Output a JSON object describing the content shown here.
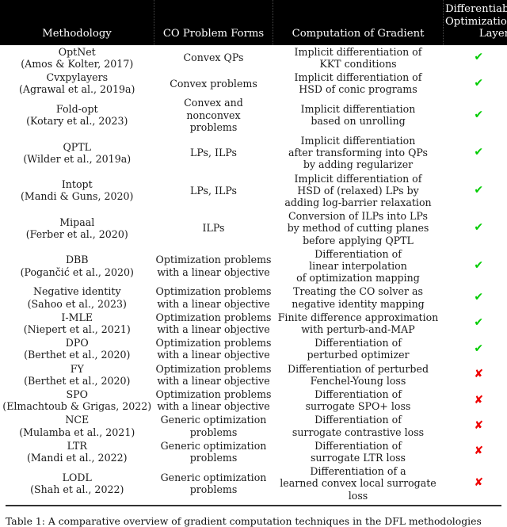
{
  "table": {
    "columns": [
      {
        "label": "Methodology"
      },
      {
        "label": "CO Problem Forms"
      },
      {
        "label": "Computation of Gradient"
      },
      {
        "label": "Differentiable\nOptimization\nLayer"
      }
    ],
    "marks": {
      "yes": "✔",
      "no": "✘"
    },
    "colors": {
      "yes": "#00cc00",
      "no": "#ee0000",
      "header_bg": "#000000",
      "header_fg": "#ffffff"
    },
    "rows": [
      {
        "methodology": "OptNet\n(Amos & Kolter, 2017)",
        "problem_forms": "Convex QPs",
        "gradient": "Implicit differentiation of\nKKT conditions",
        "layer": "yes"
      },
      {
        "methodology": "Cvxpylayers\n(Agrawal et al., 2019a)",
        "problem_forms": "Convex problems",
        "gradient": "Implicit differentiation of\nHSD of conic programs",
        "layer": "yes"
      },
      {
        "methodology": "Fold-opt\n(Kotary et al., 2023)",
        "problem_forms": "Convex and nonconvex\nproblems",
        "gradient": "Implicit differentiation\nbased on unrolling",
        "layer": "yes"
      },
      {
        "methodology": "QPTL\n(Wilder et al., 2019a)",
        "problem_forms": "LPs, ILPs",
        "gradient": "Implicit differentiation\nafter transforming into QPs\nby adding regularizer",
        "layer": "yes"
      },
      {
        "methodology": "Intopt\n(Mandi & Guns, 2020)",
        "problem_forms": "LPs, ILPs",
        "gradient": "Implicit differentiation of\nHSD of (relaxed) LPs by\nadding log-barrier relaxation",
        "layer": "yes"
      },
      {
        "methodology": "Mipaal\n(Ferber et al., 2020)",
        "problem_forms": "ILPs",
        "gradient": "Conversion of ILPs into LPs\nby method of cutting planes\nbefore applying QPTL",
        "layer": "yes"
      },
      {
        "methodology": "DBB\n(Pogančić et al., 2020)",
        "problem_forms": "Optimization problems\nwith a linear objective",
        "gradient": "Differentiation of\nlinear interpolation\nof optimization mapping",
        "layer": "yes"
      },
      {
        "methodology": "Negative identity\n(Sahoo et al., 2023)",
        "problem_forms": "Optimization problems\nwith a linear objective",
        "gradient": "Treating the CO solver as\nnegative identity mapping",
        "layer": "yes"
      },
      {
        "methodology": "I-MLE\n(Niepert et al., 2021)",
        "problem_forms": "Optimization problems\nwith a linear objective",
        "gradient": "Finite difference approximation\nwith perturb-and-MAP",
        "layer": "yes"
      },
      {
        "methodology": "DPO\n(Berthet et al., 2020)",
        "problem_forms": "Optimization problems\nwith a linear objective",
        "gradient": "Differentiation of\nperturbed optimizer",
        "layer": "yes"
      },
      {
        "methodology": "FY\n(Berthet et al., 2020)",
        "problem_forms": "Optimization problems\nwith a linear objective",
        "gradient": "Differentiation of perturbed\nFenchel-Young loss",
        "layer": "no"
      },
      {
        "methodology": "SPO\n(Elmachtoub & Grigas, 2022)",
        "problem_forms": "Optimization problems\nwith a linear objective",
        "gradient": "Differentiation of\nsurrogate SPO+ loss",
        "layer": "no"
      },
      {
        "methodology": "NCE\n(Mulamba et al., 2021)",
        "problem_forms": "Generic optimization\nproblems",
        "gradient": "Differentiation of\nsurrogate contrastive loss",
        "layer": "no"
      },
      {
        "methodology": "LTR\n(Mandi et al., 2022)",
        "problem_forms": "Generic optimization\nproblems",
        "gradient": "Differentiation of\nsurrogate LTR loss",
        "layer": "no"
      },
      {
        "methodology": "LODL\n(Shah et al., 2022)",
        "problem_forms": "Generic optimization\nproblems",
        "gradient": "Differentiation of a\nlearned convex local surrogate loss",
        "layer": "no"
      }
    ]
  },
  "caption": {
    "text": "Table 1: A comparative overview of gradient computation techniques in the DFL methodologies"
  }
}
